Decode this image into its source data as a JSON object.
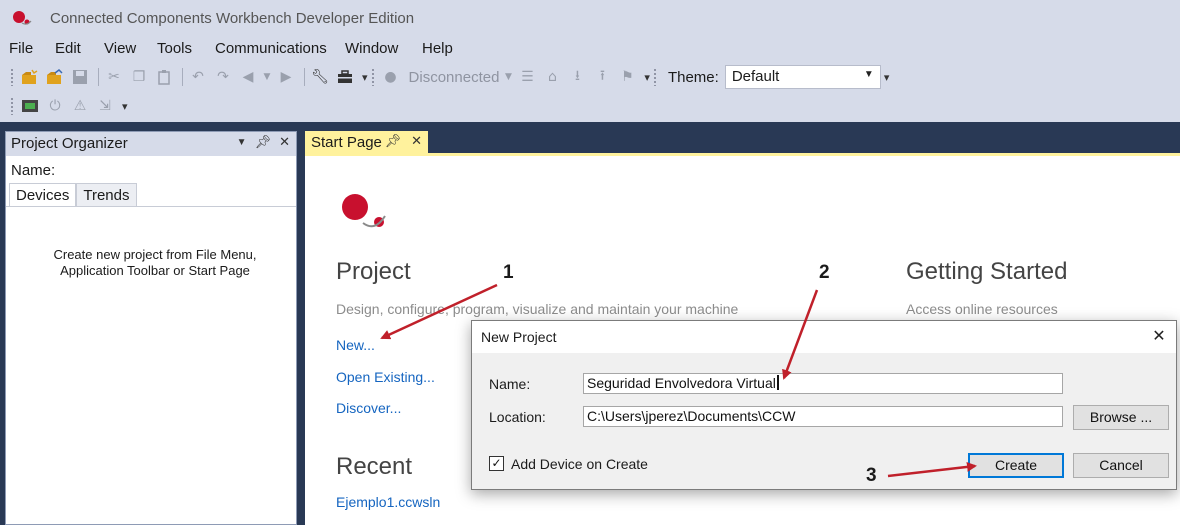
{
  "window": {
    "title": "Connected Components Workbench Developer Edition"
  },
  "menu": [
    "File",
    "Edit",
    "View",
    "Tools",
    "Communications",
    "Window",
    "Help"
  ],
  "toolbar": {
    "connection_status": "Disconnected",
    "theme_label": "Theme:",
    "theme_value": "Default"
  },
  "organizer": {
    "title": "Project Organizer",
    "name_label": "Name:",
    "tabs": [
      "Devices",
      "Trends"
    ],
    "empty_message_line1": "Create new project from File Menu,",
    "empty_message_line2": "Application Toolbar or Start Page"
  },
  "start_page": {
    "tab_label": "Start Page",
    "project_heading": "Project",
    "project_sub": "Design, configure, program, visualize and maintain your machine",
    "links": {
      "new": "New...",
      "open_existing": "Open Existing...",
      "discover": "Discover..."
    },
    "recent_heading": "Recent",
    "recent_items": [
      "Ejemplo1.ccwsln"
    ],
    "getting_started_heading": "Getting Started",
    "getting_started_sub": "Access online resources"
  },
  "dialog": {
    "title": "New Project",
    "name_label": "Name:",
    "name_value": "Seguridad Envolvedora Virtual",
    "location_label": "Location:",
    "location_value": "C:\\Users\\jperez\\Documents\\CCW",
    "browse_label": "Browse ...",
    "add_device_label": "Add Device on Create",
    "add_device_checked": true,
    "create_label": "Create",
    "cancel_label": "Cancel"
  },
  "annotations": [
    "1",
    "2",
    "3"
  ],
  "colors": {
    "accent_red": "#c8102e",
    "arrow": "#c0202a",
    "link": "#1565c0",
    "tab_yellow": "#fff29d",
    "dark_band": "#293955"
  }
}
